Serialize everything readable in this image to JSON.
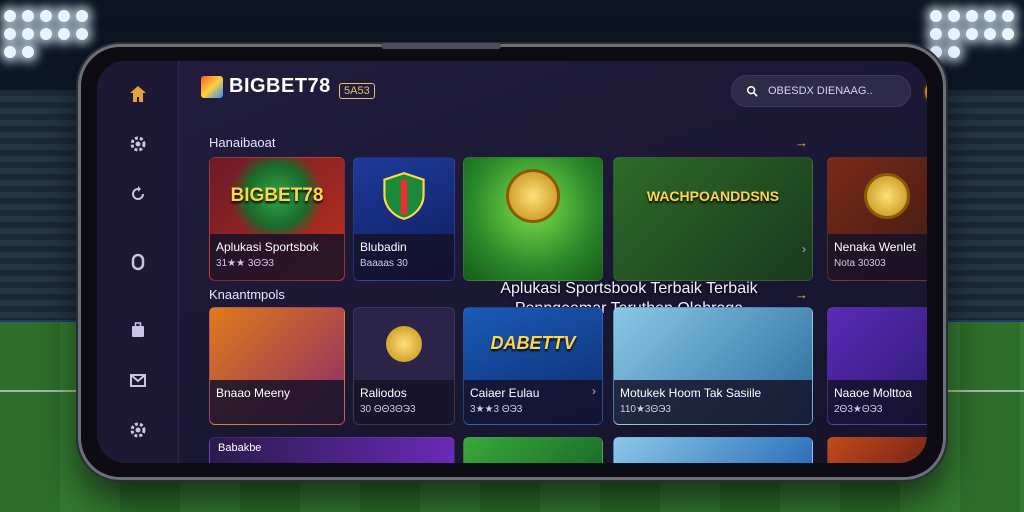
{
  "app": {
    "title": "BIGBET78",
    "tag": "5A53"
  },
  "search": {
    "placeholder": "OBESDX DIENAAG.."
  },
  "sidebar": {
    "items": [
      {
        "icon": "home-icon",
        "color": "#e6a23a"
      },
      {
        "icon": "gear-icon",
        "color": "#c9c4e3"
      },
      {
        "icon": "refresh-icon",
        "color": "#c9c4e3"
      },
      {
        "icon": "shield-icon",
        "color": "#c9c4e3"
      },
      {
        "icon": "bag-icon",
        "color": "#c9c4e3"
      },
      {
        "icon": "mail-icon",
        "color": "#c9c4e3"
      },
      {
        "icon": "settings-icon",
        "color": "#c9c4e3"
      }
    ]
  },
  "sections": [
    {
      "title": "Hanaibaoat",
      "cards": [
        {
          "title": "Aplukasi Sportsbok",
          "sub": "31★★ 3ΘЭ3",
          "art": "BIGBET78"
        },
        {
          "title": "Blubadin",
          "sub": "Baaaas 30",
          "art": ""
        },
        {
          "title": "",
          "sub": "",
          "art": ""
        },
        {
          "title": "",
          "sub": "",
          "art": "WACHPOANDDSNS"
        },
        {
          "title": "Nenaka Wenlet",
          "sub": "Nota 30303",
          "art": ""
        }
      ]
    },
    {
      "title": "Knaantmpols",
      "cards": [
        {
          "title": "Bnaao Meeny",
          "sub": "",
          "art": ""
        },
        {
          "title": "Raliodos",
          "sub": "30 ΘΘ3ΘЭ3",
          "art": ""
        },
        {
          "title": "Caiaer Eulau",
          "sub": "3★★3 ΘЭ3",
          "art": "DABETTV"
        },
        {
          "title": "Motukek Hoom Tak Sasiile",
          "sub": "110★3ΘЭ3",
          "art": ""
        },
        {
          "title": "Naaoe Molttoa",
          "sub": "2Θ3★ΘЭ3",
          "art": ""
        }
      ]
    }
  ],
  "overlay": {
    "line1": "Aplukasi Sportsbook Terbaik Terbaik",
    "line2": "Penngeemar Taruthen Olahraga"
  },
  "bottom_row": {
    "label": "Babakbe"
  }
}
